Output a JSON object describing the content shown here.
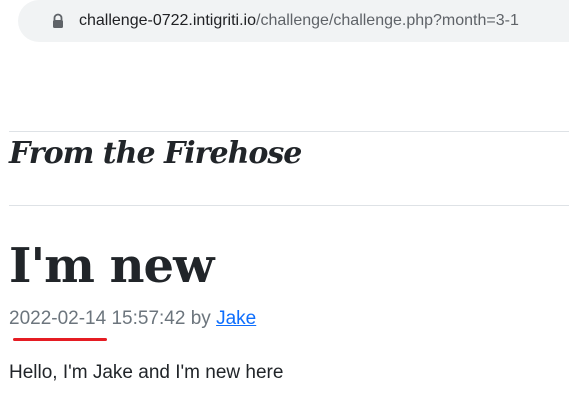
{
  "browser": {
    "url_host": "challenge-0722.intigriti.io",
    "url_path": "/challenge/challenge.php?month=3-1"
  },
  "blog": {
    "title": "From the Firehose"
  },
  "post": {
    "title": "I'm new",
    "date": "2022-02-14",
    "time": "15:57:42",
    "by_label": "by",
    "author": "Jake",
    "content": "Hello, I'm Jake and I'm new here"
  },
  "colors": {
    "annotation_underline": "#e51c23",
    "link": "#0d6efd",
    "meta_text": "#6c757d"
  }
}
